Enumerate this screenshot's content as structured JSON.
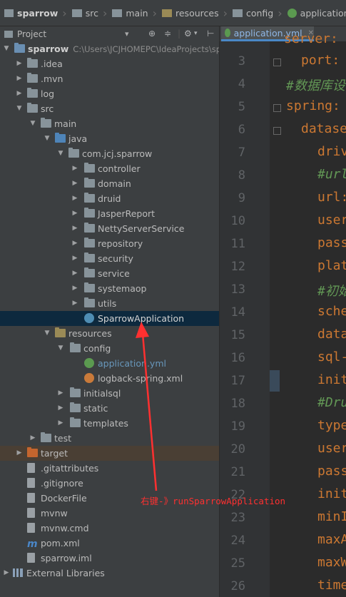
{
  "breadcrumb": [
    "sparrow",
    "src",
    "main",
    "resources",
    "config",
    "application.yml"
  ],
  "project_panel": {
    "title": "Project",
    "dropdown_arrow": "▾"
  },
  "tree": [
    {
      "label": "sparrow",
      "note": "C:\\Users\\JCJHOMEPC\\IdeaProjects\\sp",
      "type": "module"
    },
    {
      "label": ".idea",
      "type": "folder"
    },
    {
      "label": ".mvn",
      "type": "folder"
    },
    {
      "label": "log",
      "type": "folder"
    },
    {
      "label": "src",
      "type": "folder"
    },
    {
      "label": "main",
      "type": "folder"
    },
    {
      "label": "java",
      "type": "src-folder"
    },
    {
      "label": "com.jcj.sparrow",
      "type": "package"
    },
    {
      "label": "controller",
      "type": "package"
    },
    {
      "label": "domain",
      "type": "package"
    },
    {
      "label": "druid",
      "type": "package"
    },
    {
      "label": "JasperReport",
      "type": "package"
    },
    {
      "label": "NettyServerService",
      "type": "package"
    },
    {
      "label": "repository",
      "type": "package"
    },
    {
      "label": "security",
      "type": "package"
    },
    {
      "label": "service",
      "type": "package"
    },
    {
      "label": "systemaop",
      "type": "package"
    },
    {
      "label": "utils",
      "type": "package"
    },
    {
      "label": "SparrowApplication",
      "type": "spring-class"
    },
    {
      "label": "resources",
      "type": "res-folder"
    },
    {
      "label": "config",
      "type": "folder"
    },
    {
      "label": "application.yml",
      "type": "yml"
    },
    {
      "label": "logback-spring.xml",
      "type": "xml"
    },
    {
      "label": "initialsql",
      "type": "folder"
    },
    {
      "label": "static",
      "type": "folder"
    },
    {
      "label": "templates",
      "type": "folder"
    },
    {
      "label": "test",
      "type": "folder"
    },
    {
      "label": "target",
      "type": "target"
    },
    {
      "label": ".gitattributes",
      "type": "file"
    },
    {
      "label": ".gitignore",
      "type": "file"
    },
    {
      "label": "DockerFile",
      "type": "file"
    },
    {
      "label": "mvnw",
      "type": "file"
    },
    {
      "label": "mvnw.cmd",
      "type": "file"
    },
    {
      "label": "pom.xml",
      "type": "maven"
    },
    {
      "label": "sparrow.iml",
      "type": "file"
    },
    {
      "label": "External Libraries",
      "type": "lib"
    }
  ],
  "editor": {
    "tab_label": "application.yml",
    "lines": [
      {
        "n": "3",
        "text": "port:",
        "style": "key"
      },
      {
        "n": "4",
        "text": "#数据库设",
        "style": "cm"
      },
      {
        "n": "5",
        "text": "spring:",
        "style": "key"
      },
      {
        "n": "6",
        "text": "datase",
        "style": "key"
      },
      {
        "n": "7",
        "text": "driv",
        "style": "key"
      },
      {
        "n": "8",
        "text": "#url",
        "style": "cm"
      },
      {
        "n": "9",
        "text": "url:",
        "style": "key"
      },
      {
        "n": "10",
        "text": "user",
        "style": "key"
      },
      {
        "n": "11",
        "text": "pass",
        "style": "key"
      },
      {
        "n": "12",
        "text": "plat",
        "style": "key"
      },
      {
        "n": "13",
        "text": "#初始",
        "style": "cm"
      },
      {
        "n": "14",
        "text": "sche",
        "style": "key"
      },
      {
        "n": "15",
        "text": "data",
        "style": "key"
      },
      {
        "n": "16",
        "text": "sql-",
        "style": "key"
      },
      {
        "n": "17",
        "text": "init",
        "style": "key"
      },
      {
        "n": "18",
        "text": "#Dru",
        "style": "cm"
      },
      {
        "n": "19",
        "text": "type",
        "style": "key"
      },
      {
        "n": "20",
        "text": "user",
        "style": "key"
      },
      {
        "n": "21",
        "text": "pass",
        "style": "key"
      },
      {
        "n": "22",
        "text": "init",
        "style": "key"
      },
      {
        "n": "23",
        "text": "minI",
        "style": "key"
      },
      {
        "n": "24",
        "text": "maxA",
        "style": "key"
      },
      {
        "n": "25",
        "text": "maxW",
        "style": "key"
      },
      {
        "n": "26",
        "text": "time",
        "style": "key"
      }
    ],
    "top_partial": "server:"
  },
  "annotation": {
    "text": "右键-》runSparrowApplication",
    "color": "#ff3030"
  },
  "colors": {
    "selected_row": "#0d293e",
    "keyword": "#cc7832",
    "comment": "#629755",
    "link_blue": "#6897bb"
  }
}
